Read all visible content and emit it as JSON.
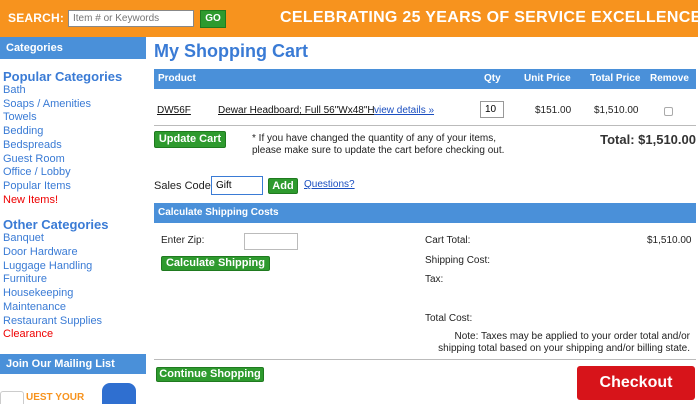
{
  "search": {
    "label": "SEARCH:",
    "placeholder": "Item # or Keywords",
    "go_label": "GO"
  },
  "banner": {
    "text": "CELEBRATING 25 YEARS OF SERVICE EXCELLENCE"
  },
  "sidebar": {
    "categories_header": "Categories",
    "popular_title": "Popular Categories",
    "popular_items": [
      "Bath",
      "Soaps / Amenities",
      "Towels",
      "Bedding",
      "Bedspreads",
      "Guest Room",
      "Office / Lobby",
      "Popular Items",
      "New Items!"
    ],
    "other_title": "Other Categories",
    "other_items": [
      "Banquet",
      "Door Hardware",
      "Luggage Handling",
      "Furniture",
      "Housekeeping",
      "Maintenance",
      "Restaurant Supplies",
      "Clearance"
    ],
    "mailing_header": "Join Our Mailing List",
    "quest_text": "UEST YOUR"
  },
  "main": {
    "title": "My Shopping Cart",
    "cart_headers": {
      "product": "Product",
      "qty": "Qty",
      "unit_price": "Unit Price",
      "total_price": "Total Price",
      "remove": "Remove"
    },
    "item": {
      "sku": "DW56F",
      "name": "Dewar Headboard; Full 56\"Wx48\"H",
      "details_link": "view details »",
      "qty": "10",
      "unit_price": "$151.00",
      "total_price": "$1,510.00"
    },
    "update_label": "Update Cart",
    "note_line1": "* If you have changed the quantity of any of your items,",
    "note_line2": "please make sure to update the cart before checking out.",
    "total": "Total: $1,510.00",
    "sales_code_label": "Sales Code:",
    "sales_code_value": "Gift",
    "add_label": "Add",
    "questions_link": "Questions?",
    "shipping_header": "Calculate Shipping Costs",
    "zip_label": "Enter Zip:",
    "calc_label": "Calculate Shipping",
    "cart_total_label": "Cart Total:",
    "cart_total_value": "$1,510.00",
    "shipping_cost_label": "Shipping Cost:",
    "tax_label": "Tax:",
    "total_cost_label": "Total Cost:",
    "tax_note_line1": "Note: Taxes may be applied to your order total and/or",
    "tax_note_line2": "shipping total based on your shipping and/or billing state.",
    "continue_label": "Continue Shopping",
    "checkout_label": "Checkout"
  }
}
